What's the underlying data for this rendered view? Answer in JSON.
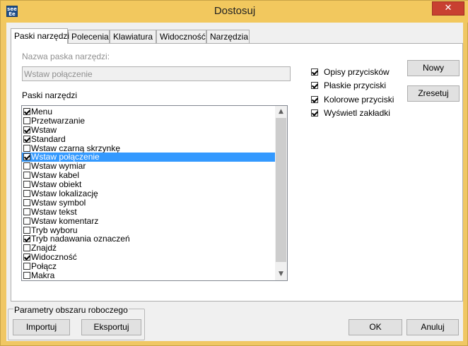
{
  "window": {
    "title": "Dostosuj",
    "app_icon_text": "see Ee",
    "close_glyph": "✕"
  },
  "tabs": [
    {
      "label": "Paski narzędzi",
      "active": true
    },
    {
      "label": "Polecenia",
      "active": false
    },
    {
      "label": "Klawiatura",
      "active": false
    },
    {
      "label": "Widoczność",
      "active": false
    },
    {
      "label": "Narzędzia",
      "active": false
    }
  ],
  "toolbar_name": {
    "label": "Nazwa paska narzędzi:",
    "value": "Wstaw połączenie"
  },
  "toolbars_list": {
    "label": "Paski narzędzi",
    "items": [
      {
        "label": "Menu",
        "checked": true,
        "selected": false
      },
      {
        "label": "Przetwarzanie",
        "checked": false,
        "selected": false
      },
      {
        "label": "Wstaw",
        "checked": true,
        "selected": false
      },
      {
        "label": "Standard",
        "checked": true,
        "selected": false
      },
      {
        "label": "Wstaw czarną skrzynkę",
        "checked": false,
        "selected": false
      },
      {
        "label": "Wstaw połączenie",
        "checked": true,
        "selected": true
      },
      {
        "label": "Wstaw wymiar",
        "checked": false,
        "selected": false
      },
      {
        "label": "Wstaw kabel",
        "checked": false,
        "selected": false
      },
      {
        "label": "Wstaw obiekt",
        "checked": false,
        "selected": false
      },
      {
        "label": "Wstaw lokalizację",
        "checked": false,
        "selected": false
      },
      {
        "label": "Wstaw symbol",
        "checked": false,
        "selected": false
      },
      {
        "label": "Wstaw tekst",
        "checked": false,
        "selected": false
      },
      {
        "label": "Wstaw komentarz",
        "checked": false,
        "selected": false
      },
      {
        "label": "Tryb wyboru",
        "checked": false,
        "selected": false
      },
      {
        "label": "Tryb nadawania oznaczeń",
        "checked": true,
        "selected": false
      },
      {
        "label": "Znajdź",
        "checked": false,
        "selected": false
      },
      {
        "label": "Widoczność",
        "checked": true,
        "selected": false
      },
      {
        "label": "Połącz",
        "checked": false,
        "selected": false
      },
      {
        "label": "Makra",
        "checked": false,
        "selected": false
      }
    ],
    "scroll_up_glyph": "▲",
    "scroll_down_glyph": "▼"
  },
  "options": [
    {
      "label": "Opisy przycisków",
      "checked": true
    },
    {
      "label": "Płaskie przyciski",
      "checked": true
    },
    {
      "label": "Kolorowe przyciski",
      "checked": true
    },
    {
      "label": "Wyświetl zakładki",
      "checked": true
    }
  ],
  "buttons": {
    "new": "Nowy",
    "reset": "Zresetuj",
    "import": "Importuj",
    "export": "Eksportuj",
    "ok": "OK",
    "cancel": "Anuluj"
  },
  "workspace_group": {
    "label": "Parametry obszaru roboczego"
  },
  "colors": {
    "title_bar": "#f2c85e",
    "close_button": "#c84031",
    "selection": "#3399ff"
  }
}
